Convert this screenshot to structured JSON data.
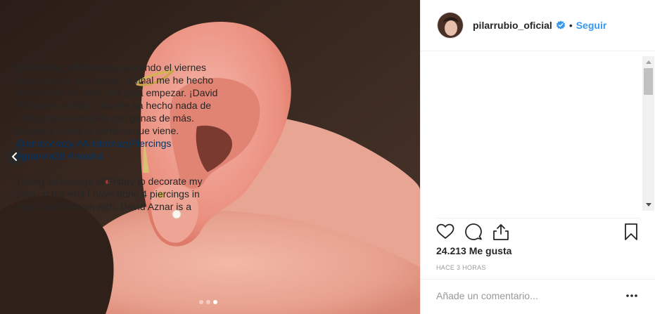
{
  "post": {
    "media": {
      "image_alt": "close-up of an ear with several piercings",
      "carousel_dots": 3,
      "active_dot": 3
    },
    "header": {
      "username": "pilarrubio_oficial",
      "separator": "•",
      "follow_label": "Seguir",
      "verified": true
    },
    "caption": {
      "username": "pilarrubio_oficial",
      "text_es": "Aprovechando el viernes para decorar mis orejas, al final me he hecho 4 piercings en cada una para empezar. ¡David Aznar es un crack! No me ha hecho nada de daño y me ha dejado con ganas de más. Prometo volver la semana que viene.",
      "mention": "@aristocrazy",
      "hashtags": "#AristocrazyPiercings #granvia26 #madrid",
      "dot_line": ".",
      "text_en": "Taking advantage of Friday to decorate my ears, at the end I have done 4 piercings in each one to begin with. David Aznar is a crack! It has not done any harm to me and has left me wanting more. I promise to come back next week."
    },
    "stats": {
      "likes": "24.213 Me gusta",
      "time": "HACE 3 HORAS"
    },
    "comment_box": {
      "placeholder": "Añade un comentario..."
    },
    "colors": {
      "link": "#3897f0",
      "hashtag": "#003569",
      "muted": "#999999",
      "text": "#262626"
    },
    "icons": [
      "heart-icon",
      "comment-icon",
      "share-icon",
      "bookmark-icon",
      "verified-badge-icon",
      "chevron-left-icon",
      "more-options-icon"
    ]
  }
}
